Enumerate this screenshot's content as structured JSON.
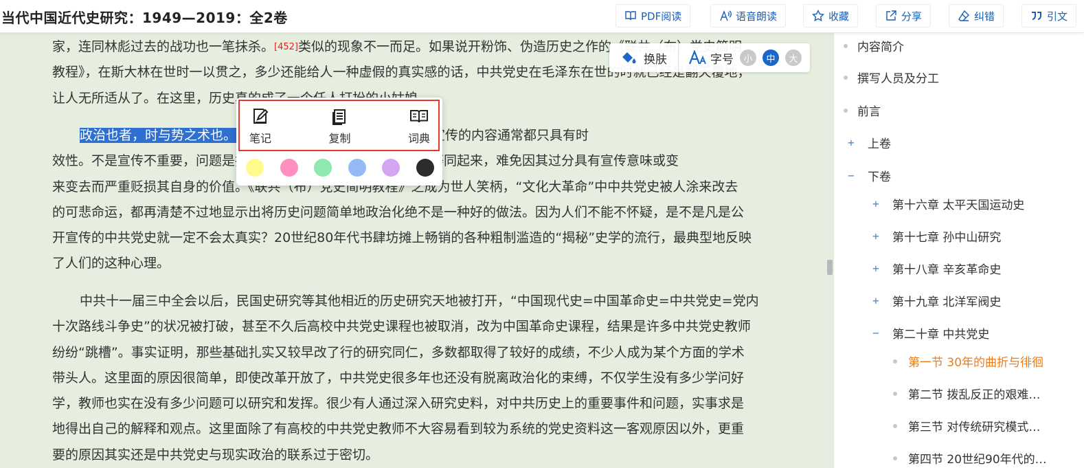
{
  "book": {
    "title": "当代中国近代史研究：1949—2019：全2卷"
  },
  "toolbar": {
    "pdf": "PDF阅读",
    "tts": "语音朗读",
    "favorite": "收藏",
    "share": "分享",
    "correct": "纠错",
    "cite": "引文"
  },
  "display": {
    "skin": "换肤",
    "fontsize_label": "字号",
    "small": "小",
    "medium": "中",
    "large": "大"
  },
  "selection_popup": {
    "note": "笔记",
    "copy": "复制",
    "dictionary": "词典",
    "colors": [
      "#fffa8c",
      "#ff8fc2",
      "#8ee8b0",
      "#94bbf5",
      "#d4a6f2",
      "#2c2c2c"
    ]
  },
  "content": {
    "p1": {
      "l1a": "家，连同林彪过去的战功也一笔抹杀。",
      "ref": "[452]",
      "l1b": "类似的现象不一而足。如果说开粉饰、伪造历史之作的《联共（布）党史简明",
      "l2": "教程》，在斯大林在世时一以贯之，多少还能给人一种虚假的真实感的话，中共党史在毛泽东在世的时就已经是翻天覆地，",
      "l3": "让人无所适从了。在这里，历史真的成了一个任人打扮的小姑娘。"
    },
    "p2": {
      "selected": "政治也者，时与势之术也。",
      "l1": "政治本身必须应时应势而变，政治宣传的内容通常都只具有时",
      "l2": "效性。不是宣传不重要，问题是把历史研究与变来变去的政治宣传等同起来，难免因其过分具有宣传意味或变",
      "l3": "来变去而严重贬损其自身的价值。《联共（布）党史简明教程》之成为世人笑柄，“文化大革命”中中共党史被人涂来改去",
      "l4": "的可悲命运，都再清楚不过地显示出将历史问题简单地政治化绝不是一种好的做法。因为人们不能不怀疑，是不是凡是公",
      "l5": "开宣传的中共党史就一定不会太真实？20世纪80年代书肆坊摊上畅销的各种粗制滥造的“揭秘”史学的流行，最典型地反映",
      "l6": "了人们的这种心理。"
    },
    "p3": {
      "l1": "中共十一届三中全会以后，民国史研究等其他相近的历史研究天地被打开，“中国现代史=中国革命史=中共党史=党内",
      "l2": "十次路线斗争史”的状况被打破，甚至不久后高校中共党史课程也被取消，改为中国革命史课程，结果是许多中共党史教师",
      "l3": "纷纷“跳槽”。事实证明，那些基础扎实又较早改了行的研究同仁，多数都取得了较好的成绩，不少人成为某个方面的学术",
      "l4": "带头人。这里面的原因很简单，即使改革开放了，中共党史很多年也还没有脱离政治化的束缚，不仅学生没有多少学问好",
      "l5": "学，教师也实在没有多少问题可以研究和发挥。很少有人通过深入研究史料，对中共历史上的重要事件和问题，实事求是",
      "l6": "地得出自己的解释和观点。这里面除了有高校的中共党史教师不大容易看到较为系统的党史资料这一客观原因以外，更重",
      "l7": "要的原因其实还是中共党史与现实政治的联系过于密切。"
    }
  },
  "toc": {
    "intro": "内容简介",
    "authors": "撰写人员及分工",
    "preface": "前言",
    "vol1": "上卷",
    "vol2": "下卷",
    "ch16": "第十六章 太平天国运动史",
    "ch17": "第十七章 孙中山研究",
    "ch18": "第十八章 辛亥革命史",
    "ch19": "第十九章 北洋军阀史",
    "ch20": "第二十章 中共党史",
    "s1": "第一节 30年的曲折与徘徊",
    "s2": "第二节 拨乱反正的艰难…",
    "s3": "第三节 对传统研究模式…",
    "s4": "第四节 20世纪90年代的…",
    "expand": "+",
    "collapse": "−"
  }
}
